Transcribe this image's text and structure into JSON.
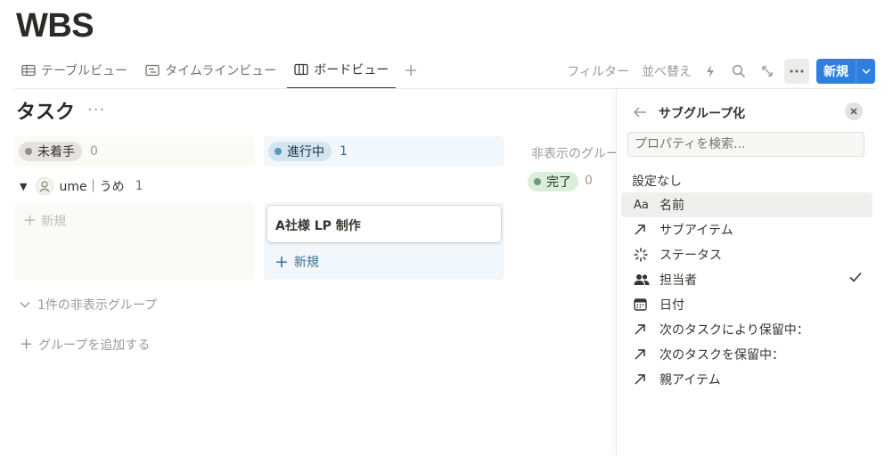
{
  "page": {
    "title": "WBS"
  },
  "tabs": [
    {
      "label": "テーブルビュー",
      "icon": "table-icon",
      "active": false
    },
    {
      "label": "タイムラインビュー",
      "icon": "timeline-icon",
      "active": false
    },
    {
      "label": "ボードビュー",
      "icon": "board-icon",
      "active": true
    }
  ],
  "toolbar": {
    "filter_label": "フィルター",
    "sort_label": "並べ替え",
    "new_label": "新規"
  },
  "board": {
    "title": "タスク",
    "columns": [
      {
        "status": "未着手",
        "count": "0",
        "color": "#91918e"
      },
      {
        "status": "進行中",
        "count": "1",
        "color": "#5b97bd"
      }
    ],
    "hidden_column_label": "非表示のグループ",
    "hidden_column": {
      "status": "完了",
      "count": "0",
      "color": "#6c9b7d"
    },
    "subgroup": {
      "name": "ume｜うめ",
      "count": "1"
    },
    "new_label": "新規",
    "cards": [
      {
        "title": "A社様 LP 制作"
      }
    ],
    "hidden_groups_label": "1件の非表示グループ",
    "add_group_label": "グループを追加する"
  },
  "panel": {
    "title": "サブグループ化",
    "search_placeholder": "プロパティを検索...",
    "none_label": "設定なし",
    "properties": [
      {
        "label": "名前",
        "icon": "text-aa-icon",
        "selected": true,
        "checked": false
      },
      {
        "label": "サブアイテム",
        "icon": "relation-arrow-icon",
        "selected": false,
        "checked": false
      },
      {
        "label": "ステータス",
        "icon": "status-loader-icon",
        "selected": false,
        "checked": false
      },
      {
        "label": "担当者",
        "icon": "people-icon",
        "selected": false,
        "checked": true
      },
      {
        "label": "日付",
        "icon": "calendar-icon",
        "selected": false,
        "checked": false
      },
      {
        "label": "次のタスクにより保留中：",
        "icon": "relation-arrow-icon",
        "selected": false,
        "checked": false
      },
      {
        "label": "次のタスクを保留中：",
        "icon": "relation-arrow-icon",
        "selected": false,
        "checked": false
      },
      {
        "label": "親アイテム",
        "icon": "relation-arrow-icon",
        "selected": false,
        "checked": false
      }
    ]
  },
  "colors": {
    "accent": "#2f7fe0",
    "text": "#37352f",
    "muted": "#9b9a97"
  }
}
